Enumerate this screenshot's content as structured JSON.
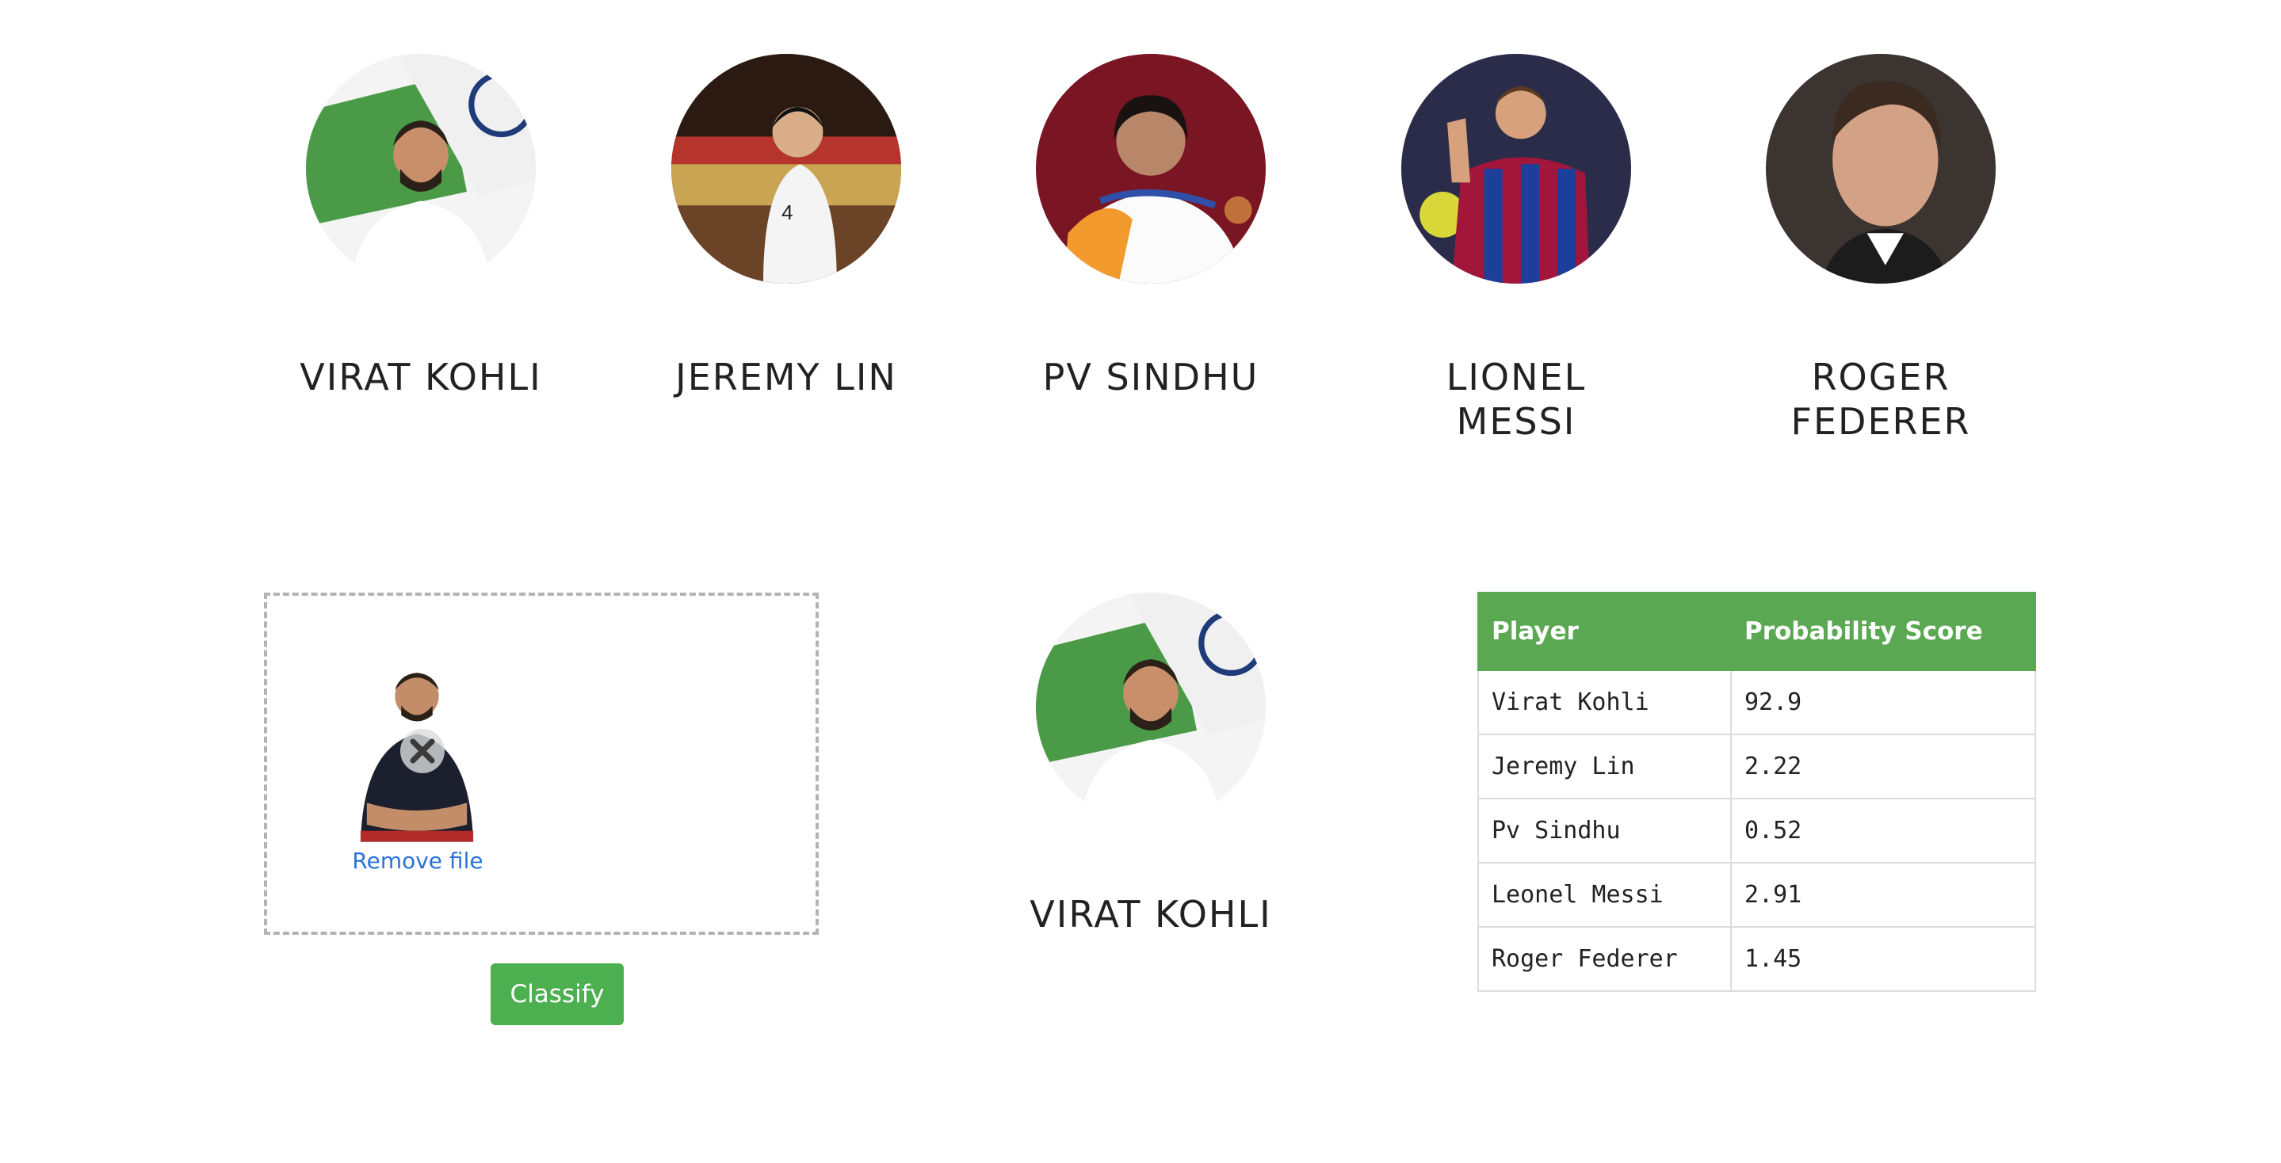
{
  "players": [
    {
      "name": "VIRAT KOHLI"
    },
    {
      "name": "JEREMY LIN"
    },
    {
      "name": "PV SINDHU"
    },
    {
      "name": "LIONEL\nMESSI"
    },
    {
      "name": "ROGER\nFEDERER"
    }
  ],
  "upload": {
    "remove_label": "Remove file",
    "classify_label": "Classify"
  },
  "result": {
    "name": "VIRAT KOHLI"
  },
  "table": {
    "headers": [
      "Player",
      "Probability Score"
    ],
    "rows": [
      [
        "Virat Kohli",
        "92.9"
      ],
      [
        "Jeremy Lin",
        "2.22"
      ],
      [
        "Pv Sindhu",
        "0.52"
      ],
      [
        "Leonel Messi",
        "2.91"
      ],
      [
        "Roger Federer",
        "1.45"
      ]
    ]
  },
  "colors": {
    "accent_green": "#5aa952",
    "button_green": "#4caf50",
    "link_blue": "#2a73d9"
  }
}
